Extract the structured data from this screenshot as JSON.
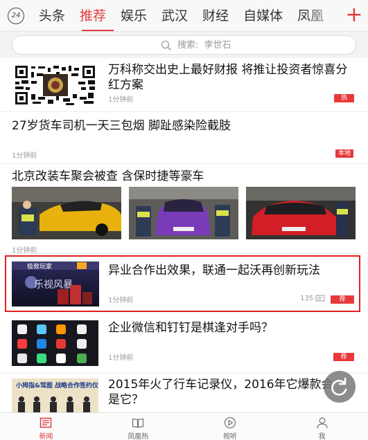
{
  "header": {
    "tab_24": "24",
    "tabs": [
      {
        "label": "头条"
      },
      {
        "label": "推荐"
      },
      {
        "label": "娱乐"
      },
      {
        "label": "武汉"
      },
      {
        "label": "财经"
      },
      {
        "label": "自媒体"
      },
      {
        "label": "凤凰"
      }
    ],
    "active_tab": "推荐",
    "plus": "+"
  },
  "search": {
    "label": "搜索:",
    "hot_word": "李世石",
    "icon": "search-icon"
  },
  "feed": [
    {
      "title": "万科称交出史上最好财报 将推让投资者惊喜分红方案",
      "time": "1分钟前",
      "badge": "热",
      "image": "qr-code"
    },
    {
      "title": "27岁货车司机一天三包烟 脚趾感染险截肢",
      "time": "1分钟前",
      "badge": "本地"
    },
    {
      "title": "北京改装车聚会被查 含保时捷等豪车",
      "time": "1分钟前",
      "images": [
        "yellow-sports-car",
        "purple-car",
        "red-car"
      ]
    },
    {
      "title": "异业合作出效果，联通一起沃再创新玩法",
      "time": "1分钟前",
      "comments": "135",
      "badge": "荐",
      "image_text": "乐视风暴",
      "highlighted": true
    },
    {
      "title": "企业微信和钉钉是棋逢对手吗？",
      "time": "1分钟前",
      "badge": "荐",
      "image": "phone-app-icons"
    },
    {
      "title": "2015年火了行车记录仪，2016年它爆款会是它？",
      "image_text": "小拇指&驾图 战略合作签约仪式"
    }
  ],
  "bottom_nav": [
    {
      "label": "新闻",
      "icon": "news-icon",
      "active": true
    },
    {
      "label": "凤凰热",
      "icon": "book-icon"
    },
    {
      "label": "视听",
      "icon": "play-icon"
    },
    {
      "label": "我",
      "icon": "user-icon"
    }
  ],
  "colors": {
    "accent": "#e23b3b",
    "badge": "#e8393a",
    "highlight_border": "#e0201f"
  }
}
